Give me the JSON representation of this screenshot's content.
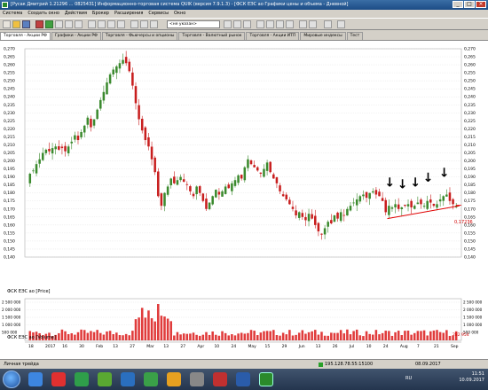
{
  "window": {
    "title": "[Русак Дмитрий 1.21296 ... 0825431] Информационно-торговая система QUIK (версия 7.9.1.3) - [ФСК ЕЭС ао Графики цены и объема - Дневной]",
    "buttons": [
      "_",
      "□",
      "×"
    ]
  },
  "menu": [
    "Система",
    "Создать окно",
    "Действия",
    "Брокер",
    "Расширения",
    "Сервисы",
    "Окно"
  ],
  "toolbar": {
    "account_select": "<не указан>"
  },
  "tabs": [
    "Торговля - Акции РФ",
    "Графики - Акции РФ",
    "Торговля - Фьючерсы и опционы",
    "Торговля - Валютный рынок",
    "Торговля - Акции ИТП",
    "Мировые индексы",
    "Тест"
  ],
  "chart_data": [
    {
      "type": "candlestick",
      "legend": "ФСК ЕЭС ао [Price]",
      "ylim": [
        0.14,
        0.27
      ],
      "yticks": [
        "0,270",
        "0,265",
        "0,260",
        "0,255",
        "0,250",
        "0,245",
        "0,240",
        "0,235",
        "0,230",
        "0,225",
        "0,220",
        "0,215",
        "0,210",
        "0,205",
        "0,200",
        "0,195",
        "0,190",
        "0,185",
        "0,180",
        "0,175",
        "0,170",
        "0,165",
        "0,160",
        "0,155",
        "0,150",
        "0,145",
        "0,140"
      ],
      "last_price": "0,17236",
      "close_series": [
        0.192,
        0.194,
        0.198,
        0.201,
        0.205,
        0.207,
        0.206,
        0.208,
        0.209,
        0.207,
        0.208,
        0.206,
        0.209,
        0.212,
        0.216,
        0.213,
        0.218,
        0.222,
        0.227,
        0.221,
        0.226,
        0.232,
        0.238,
        0.243,
        0.249,
        0.254,
        0.257,
        0.259,
        0.261,
        0.263,
        0.261,
        0.256,
        0.247,
        0.236,
        0.226,
        0.219,
        0.213,
        0.209,
        0.201,
        0.193,
        0.178,
        0.172,
        0.18,
        0.184,
        0.189,
        0.186,
        0.188,
        0.19,
        0.187,
        0.185,
        0.181,
        0.178,
        0.184,
        0.18,
        0.175,
        0.17,
        0.174,
        0.178,
        0.182,
        0.179,
        0.181,
        0.184,
        0.183,
        0.186,
        0.188,
        0.191,
        0.189,
        0.196,
        0.201,
        0.198,
        0.196,
        0.194,
        0.192,
        0.195,
        0.199,
        0.193,
        0.189,
        0.186,
        0.181,
        0.178,
        0.176,
        0.173,
        0.17,
        0.166,
        0.168,
        0.165,
        0.163,
        0.167,
        0.164,
        0.16,
        0.156,
        0.154,
        0.158,
        0.162,
        0.161,
        0.166,
        0.164,
        0.168,
        0.166,
        0.17,
        0.172,
        0.174,
        0.176,
        0.178,
        0.179,
        0.177,
        0.18,
        0.181,
        0.179,
        0.178,
        0.175,
        0.168,
        0.172,
        0.171,
        0.173,
        0.17,
        0.171,
        0.172,
        0.173,
        0.171,
        0.172,
        0.174,
        0.173,
        0.172,
        0.175,
        0.174,
        0.172,
        0.173,
        0.176,
        0.178,
        0.179,
        0.175,
        0.173,
        0.172
      ],
      "markers": [
        "↓",
        "↓",
        "↓",
        "↓",
        "↓"
      ]
    },
    {
      "type": "bar",
      "legend": "ФСК ЕЭС ао [Volume]",
      "yticks": [
        "2 500 000",
        "2 000 000",
        "1 500 000",
        "1 000 000",
        "500 000"
      ],
      "last_volume": "282 954",
      "xlabels": [
        "18",
        "2017",
        "16",
        "30",
        "Feb",
        "13",
        "27",
        "Mar",
        "13",
        "27",
        "Apr",
        "10",
        "24",
        "May",
        "15",
        "29",
        "Jun",
        "13",
        "26",
        "Jul",
        "10",
        "24",
        "Aug",
        "7",
        "21",
        "Sep"
      ]
    }
  ],
  "statusbar": {
    "left": "Личная трейда",
    "connection": "195.128.78.55:15100",
    "date": "08.09.2017"
  },
  "taskbar": {
    "lang": "RU",
    "time": "11:51",
    "date": "10.09.2017"
  }
}
